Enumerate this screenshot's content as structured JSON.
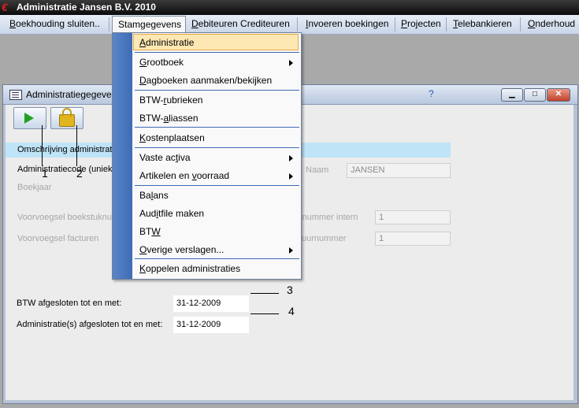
{
  "app": {
    "title": "Administratie Jansen B.V. 2010",
    "icon": "app-logo-icon"
  },
  "menubar": {
    "items": [
      {
        "label": "Boekhouding sluiten..",
        "mn": "B",
        "rest": "oekhouding sluiten.."
      },
      {
        "label": "Stamgegevens",
        "mn": "S",
        "rest": "tamgegevens"
      },
      {
        "label": "Debiteuren Crediteuren",
        "mn": "D",
        "rest": "ebiteuren Crediteuren"
      },
      {
        "label": "Invoeren boekingen",
        "mn": "I",
        "rest": "nvoeren boekingen"
      },
      {
        "label": "Projecten",
        "mn": "P",
        "rest": "rojecten"
      },
      {
        "label": "Telebankieren",
        "mn": "T",
        "rest": "elebankieren"
      },
      {
        "label": "Onderhoud",
        "mn": "O",
        "rest": "nderhoud"
      }
    ]
  },
  "dropdown": {
    "items": [
      {
        "label": "Administratie",
        "pre": "",
        "mn": "A",
        "post": "dministratie"
      },
      {
        "label": "Grootboek",
        "pre": "",
        "mn": "G",
        "post": "rootboek"
      },
      {
        "label": "Dagboeken aanmaken/bekijken",
        "pre": "",
        "mn": "D",
        "post": "agboeken aanmaken/bekijken"
      },
      {
        "label": "BTW-rubrieken",
        "pre": "BTW-",
        "mn": "r",
        "post": "ubrieken"
      },
      {
        "label": "BTW-aliassen",
        "pre": "BTW-",
        "mn": "a",
        "post": "liassen"
      },
      {
        "label": "Kostenplaatsen",
        "pre": "",
        "mn": "K",
        "post": "ostenplaatsen"
      },
      {
        "label": "Vaste activa",
        "pre": "Vaste ac",
        "mn": "t",
        "post": "iva"
      },
      {
        "label": "Artikelen en voorraad",
        "pre": "Artikelen en ",
        "mn": "v",
        "post": "oorraad"
      },
      {
        "label": "Balans",
        "pre": "Ba",
        "mn": "l",
        "post": "ans"
      },
      {
        "label": "Auditfile maken",
        "pre": "Aud",
        "mn": "i",
        "post": "tfile maken"
      },
      {
        "label": "BTW",
        "pre": "BT",
        "mn": "W",
        "post": ""
      },
      {
        "label": "Overige verslagen...",
        "pre": "",
        "mn": "O",
        "post": "verige verslagen..."
      },
      {
        "label": "Koppelen administraties",
        "pre": "",
        "mn": "K",
        "post": "oppelen administraties"
      }
    ]
  },
  "window": {
    "title": "Administratiegegeve",
    "help": "?",
    "buttons": {
      "minimize": "minimize-icon",
      "maximize": "maximize-icon",
      "close": "close-icon"
    },
    "toolbar": {
      "play": "play-icon",
      "lock": "lock-icon"
    }
  },
  "form": {
    "omschrijving_label": "Omschrijving administratie",
    "code_label": "Administratiecode (uniek)",
    "boekjaar_label": "Boekjaar",
    "voorvoegsel_boekstuk_label": "Voorvoegsel boekstuknu",
    "voorvoegsel_facturen_label": "Voorvoegsel facturen",
    "naam_label": "Naam",
    "naam_value": "JANSEN",
    "boekstuk_intern_label": "knummer intern",
    "boekstuk_intern_value": "1",
    "factuurnummer_label": "uurnummer",
    "factuurnummer_value": "1",
    "btw_afgesloten_label": "BTW afgesloten tot en met:",
    "btw_afgesloten_value": "31-12-2009",
    "adm_afgesloten_label": "Administratie(s) afgesloten tot en met:",
    "adm_afgesloten_value": "31-12-2009"
  },
  "callouts": {
    "c1": "1",
    "c2": "2",
    "c3": "3",
    "c4": "4"
  }
}
